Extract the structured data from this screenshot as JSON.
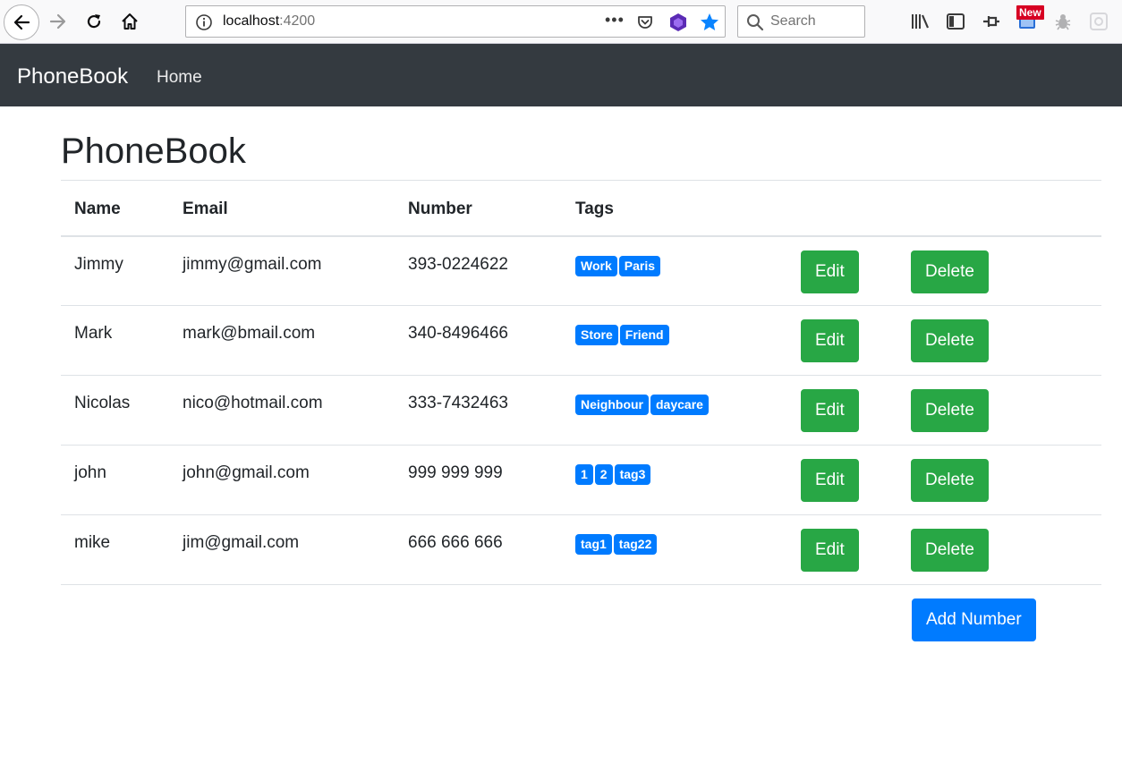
{
  "browser": {
    "url_host": "localhost",
    "url_port": ":4200",
    "search_placeholder": "Search",
    "new_badge": "New",
    "icons": {
      "back": "back-arrow-icon",
      "forward": "forward-arrow-icon",
      "reload": "reload-icon",
      "home": "home-icon",
      "info": "info-icon",
      "more": "page-actions-icon",
      "pocket": "pocket-icon",
      "extension": "extension-icon",
      "bookmark": "star-icon",
      "search": "search-icon",
      "library": "library-icon",
      "sidebar": "sidebar-icon",
      "pin": "pin-icon",
      "screenshot": "screenshot-icon",
      "bug": "bug-icon",
      "addon": "addon-icon"
    },
    "more_glyph": "•••"
  },
  "navbar": {
    "brand": "PhoneBook",
    "home_link": "Home"
  },
  "main": {
    "title": "PhoneBook",
    "columns": [
      "Name",
      "Email",
      "Number",
      "Tags"
    ],
    "contacts": [
      {
        "name": "Jimmy",
        "email": "jimmy@gmail.com",
        "number": "393-0224622",
        "tags": [
          "Work",
          "Paris"
        ]
      },
      {
        "name": "Mark",
        "email": "mark@bmail.com",
        "number": "340-8496466",
        "tags": [
          "Store",
          "Friend"
        ]
      },
      {
        "name": "Nicolas",
        "email": "nico@hotmail.com",
        "number": "333-7432463",
        "tags": [
          "Neighbour",
          "daycare"
        ]
      },
      {
        "name": "john",
        "email": "john@gmail.com",
        "number": "999 999 999",
        "tags": [
          "1",
          "2",
          "tag3"
        ]
      },
      {
        "name": "mike",
        "email": "jim@gmail.com",
        "number": "666 666 666",
        "tags": [
          "tag1",
          "tag22"
        ]
      }
    ],
    "edit_label": "Edit",
    "delete_label": "Delete",
    "add_label": "Add Number"
  },
  "colors": {
    "navbar_bg": "#343a40",
    "success": "#28a745",
    "primary": "#007bff"
  }
}
